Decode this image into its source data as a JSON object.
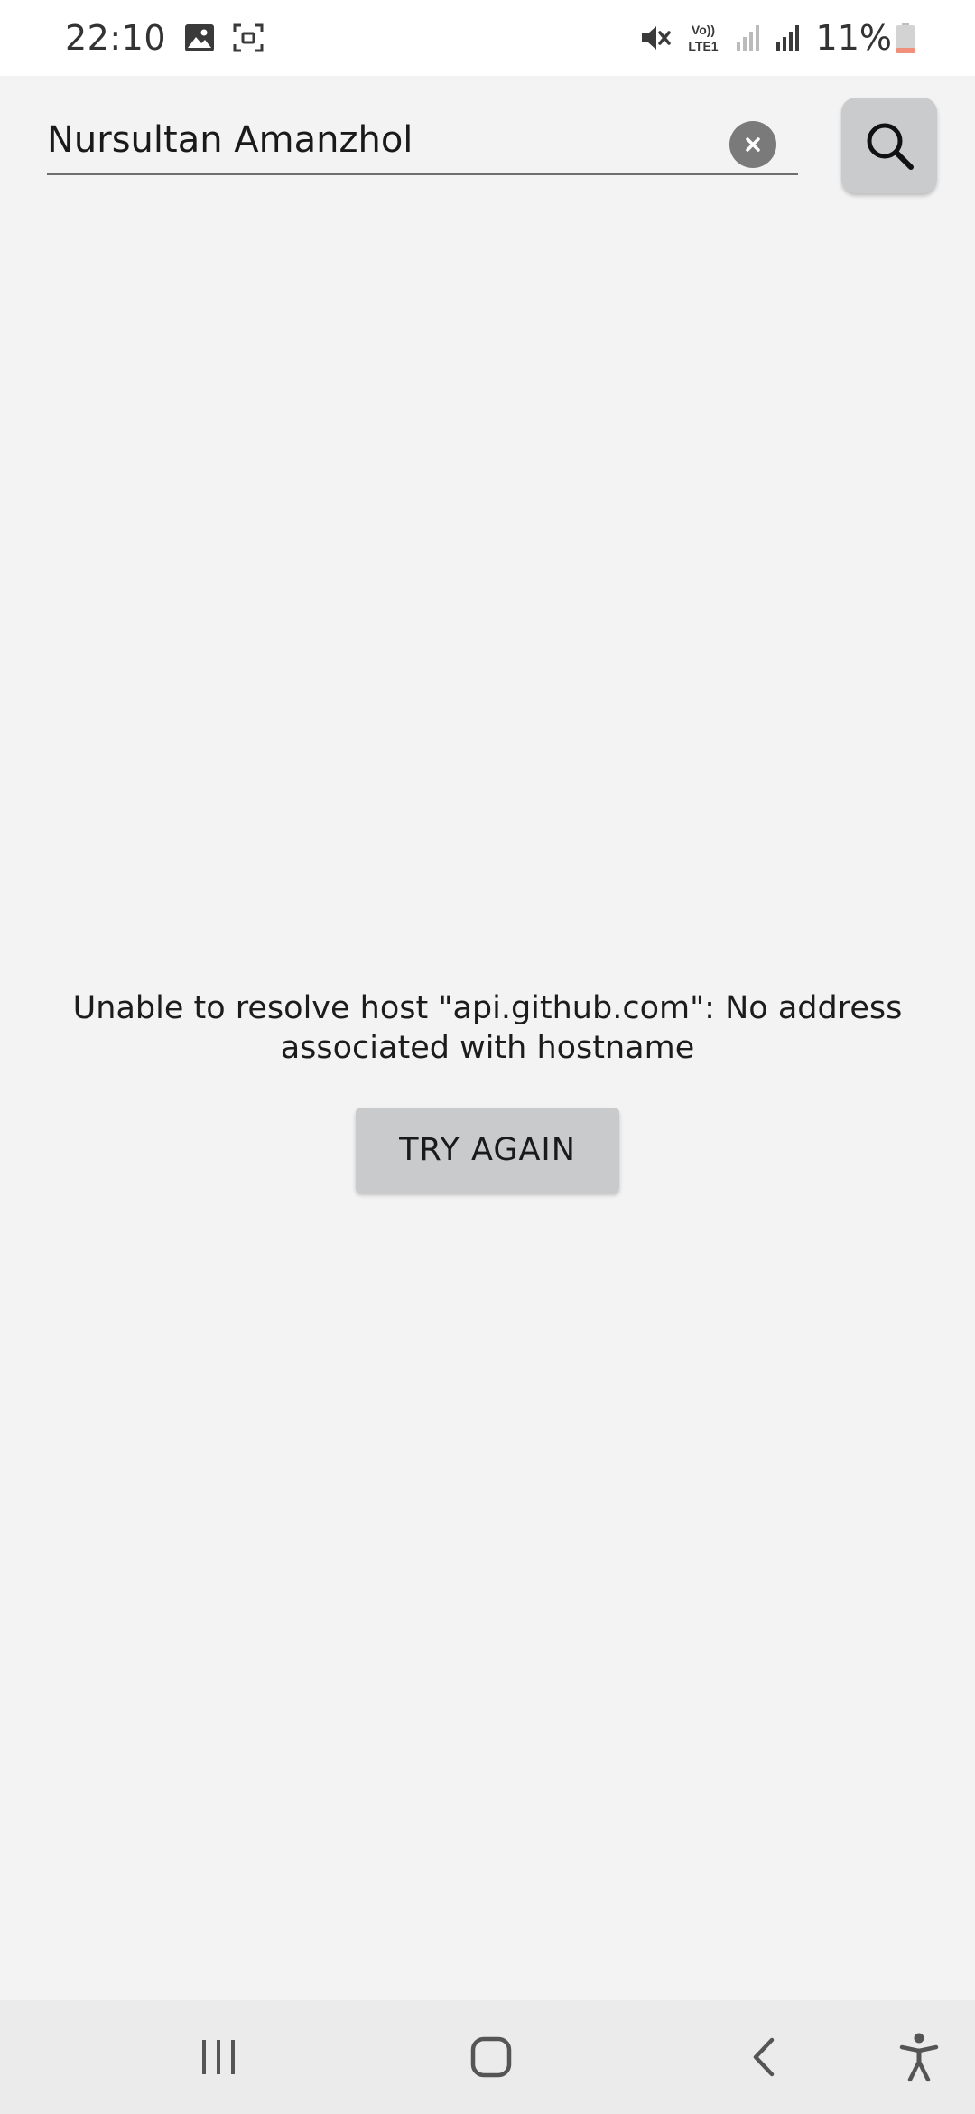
{
  "status_bar": {
    "time": "22:10",
    "battery_percent": "11%",
    "network_label_top": "Vo))",
    "network_label_bottom": "LTE1",
    "icons": [
      "image-icon",
      "screen-record-icon",
      "mute-icon",
      "volte-icon",
      "signal-weak-icon",
      "signal-icon",
      "battery-low-icon"
    ],
    "battery_color": "#f0907a"
  },
  "search": {
    "value": "Nursultan Amanzhol",
    "clear_icon": "clear-icon",
    "search_icon": "search-icon"
  },
  "error": {
    "message": "Unable to resolve host \"api.github.com\": No address associated with hostname",
    "retry_label": "TRY AGAIN"
  },
  "nav_bar": {
    "items": [
      "recent-apps-icon",
      "home-icon",
      "back-icon",
      "accessibility-icon"
    ]
  },
  "colors": {
    "background": "#f3f3f3",
    "button": "#c8cacb",
    "clear_button": "#7a7a7a"
  }
}
